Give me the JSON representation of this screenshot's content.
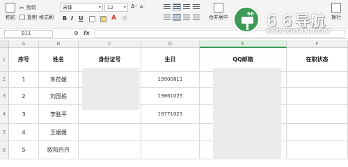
{
  "ribbon": {
    "paste": "粘贴",
    "cut": "剪切",
    "copy": "复制",
    "format_painter": "格式刷",
    "font_name": "宋体",
    "font_size": "12",
    "bold": "B",
    "italic": "I",
    "underline": "U",
    "merge_center": "合并居中",
    "wrap": "换行"
  },
  "formula_bar": {
    "cell_ref": "B11",
    "zoom_icon": "zoom-icon",
    "fx": "fx"
  },
  "columns": [
    "A",
    "B",
    "C",
    "D",
    "E",
    "F"
  ],
  "rows": [
    "1",
    "2",
    "3",
    "4",
    "5",
    "6"
  ],
  "table": {
    "headers": [
      "序号",
      "姓名",
      "身份证号",
      "生日",
      "QQ邮箱",
      "在职状态"
    ],
    "data": [
      {
        "no": "1",
        "name": "朱莅媛",
        "birth": "19900811"
      },
      {
        "no": "2",
        "name": "刘国栋",
        "birth": "19861025"
      },
      {
        "no": "3",
        "name": "李胜平",
        "birth": "19771023"
      },
      {
        "no": "4",
        "name": "王媛媛",
        "birth": ""
      },
      {
        "no": "5",
        "name": "欧阳丹丹",
        "birth": ""
      }
    ]
  },
  "watermark": {
    "logo_digits": "66",
    "title": "６６导航",
    "url": "66DAOHAN.COM",
    "logo_color": "#3d9b57"
  }
}
